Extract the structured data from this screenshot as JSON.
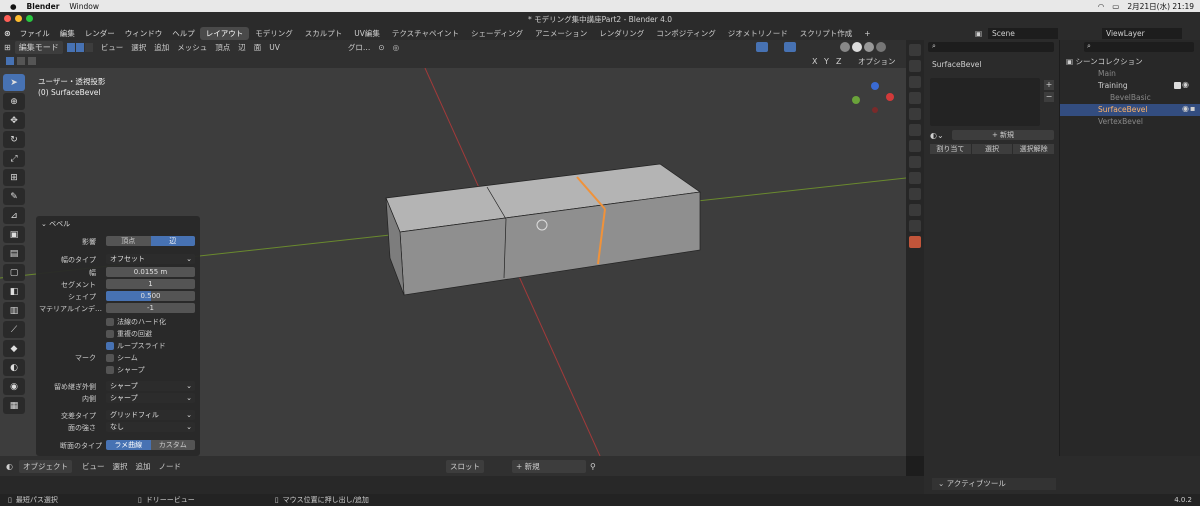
{
  "macbar": {
    "app": "Blender",
    "menu": [
      "Window"
    ],
    "clock": "2月21日(水) 21:19"
  },
  "window": {
    "title": "* モデリング集中講座Part2 - Blender 4.0"
  },
  "menubar": {
    "items": [
      "ファイル",
      "編集",
      "レンダー",
      "ウィンドウ",
      "ヘルプ"
    ],
    "workspaces": [
      "レイアウト",
      "モデリング",
      "スカルプト",
      "UV編集",
      "テクスチャペイント",
      "シェーディング",
      "アニメーション",
      "レンダリング",
      "コンポジティング",
      "ジオメトリノード",
      "スクリプト作成"
    ],
    "active_workspace": "レイアウト",
    "scene": "Scene",
    "viewlayer": "ViewLayer"
  },
  "header": {
    "mode": "編集モード",
    "menu": [
      "ビュー",
      "選択",
      "追加",
      "メッシュ",
      "頂点",
      "辺",
      "面",
      "UV"
    ],
    "transform": "グロ…",
    "options": "オプション",
    "axes": [
      "X",
      "Y",
      "Z"
    ]
  },
  "viewport": {
    "view_name": "ユーザー・透視投影",
    "object_name": "(0) SurfaceBevel"
  },
  "bevel_panel": {
    "title": "ベベル",
    "affect_label": "影響",
    "affect_options": [
      "頂点",
      "辺"
    ],
    "affect_selected": "辺",
    "width_type_label": "幅のタイプ",
    "width_type": "オフセット",
    "width_label": "幅",
    "width": "0.0155 m",
    "segments_label": "セグメント",
    "segments": "1",
    "shape_label": "シェイプ",
    "shape": "0.500",
    "shape_fraction": 0.5,
    "material_label": "マテリアルインデ…",
    "material": "-1",
    "checks": [
      {
        "label": "法線のハード化",
        "checked": false
      },
      {
        "label": "重複の回避",
        "checked": false
      },
      {
        "label": "ループスライド",
        "checked": true
      }
    ],
    "mark_label": "マーク",
    "marks": [
      {
        "label": "シーム",
        "checked": false
      },
      {
        "label": "シャープ",
        "checked": false
      }
    ],
    "miter_outer_label": "留め継ぎ外側",
    "miter_outer": "シャープ",
    "miter_inner_label": "内側",
    "miter_inner": "シャープ",
    "intersection_label": "交差タイプ",
    "intersection": "グリッドフィル",
    "face_strength_label": "面の強さ",
    "face_strength": "なし",
    "profile_label": "断面のタイプ",
    "profile_options": [
      "ラメ曲線",
      "カスタム"
    ],
    "profile_selected": "ラメ曲線"
  },
  "properties": {
    "object": "SurfaceBevel",
    "new_label": "新規",
    "buttons": [
      "割り当て",
      "選択",
      "選択解除"
    ]
  },
  "outliner": {
    "title": "シーンコレクション",
    "items": [
      {
        "name": "Main",
        "level": 1,
        "active": false
      },
      {
        "name": "Training",
        "level": 1,
        "active": false
      },
      {
        "name": "BevelBasic",
        "level": 2,
        "active": false
      },
      {
        "name": "SurfaceBevel",
        "level": 1,
        "active": true
      },
      {
        "name": "VertexBevel",
        "level": 1,
        "active": false
      }
    ]
  },
  "bottom": {
    "mode": "オブジェクト",
    "menu": [
      "ビュー",
      "選択",
      "追加",
      "ノード"
    ],
    "slot": "スロット",
    "new_label": "新規",
    "active_tool": "アクティブツール"
  },
  "statusbar": {
    "items": [
      "最短パス選択",
      "ドリーービュー",
      "マウス位置に押し出し/追加"
    ],
    "version": "4.0.2"
  }
}
